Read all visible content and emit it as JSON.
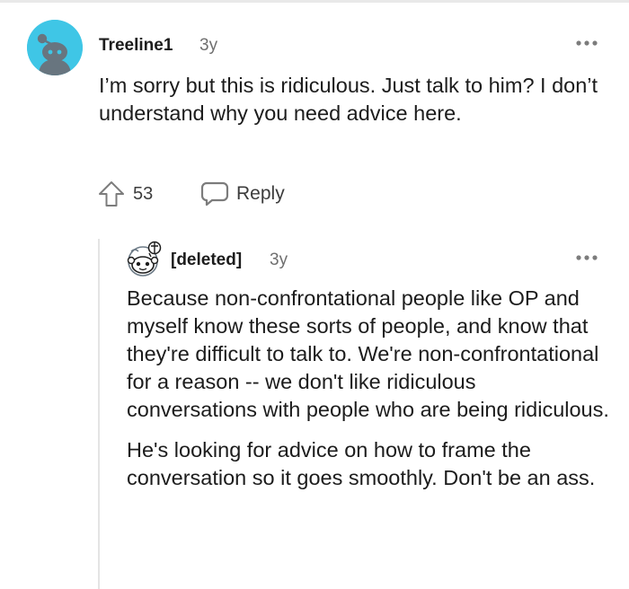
{
  "comment": {
    "author": "Treeline1",
    "age": "3y",
    "body": "I’m sorry but this is ridiculous. Just talk to him? I don’t understand why you need advice here.",
    "score": "53",
    "reply_label": "Reply",
    "avatar_color": "#3fc6e6"
  },
  "reply": {
    "author": "[deleted]",
    "age": "3y",
    "paragraphs": [
      "Because non-confrontational people like OP and myself know these sorts of people, and know that they're difficult to talk to. We're non-confrontational for a reason -- we don't like ridiculous conversations with people who are being ridiculous.",
      "He's looking for advice on how to frame the conversation so it goes smoothly. Don't be an ass."
    ]
  },
  "icons": {
    "avatar": "reddit-snoo-avatar",
    "more": "more-options-icon",
    "upvote": "upvote-arrow-icon",
    "reply": "speech-bubble-icon",
    "deleted_avatar": "deleted-user-avatar"
  }
}
